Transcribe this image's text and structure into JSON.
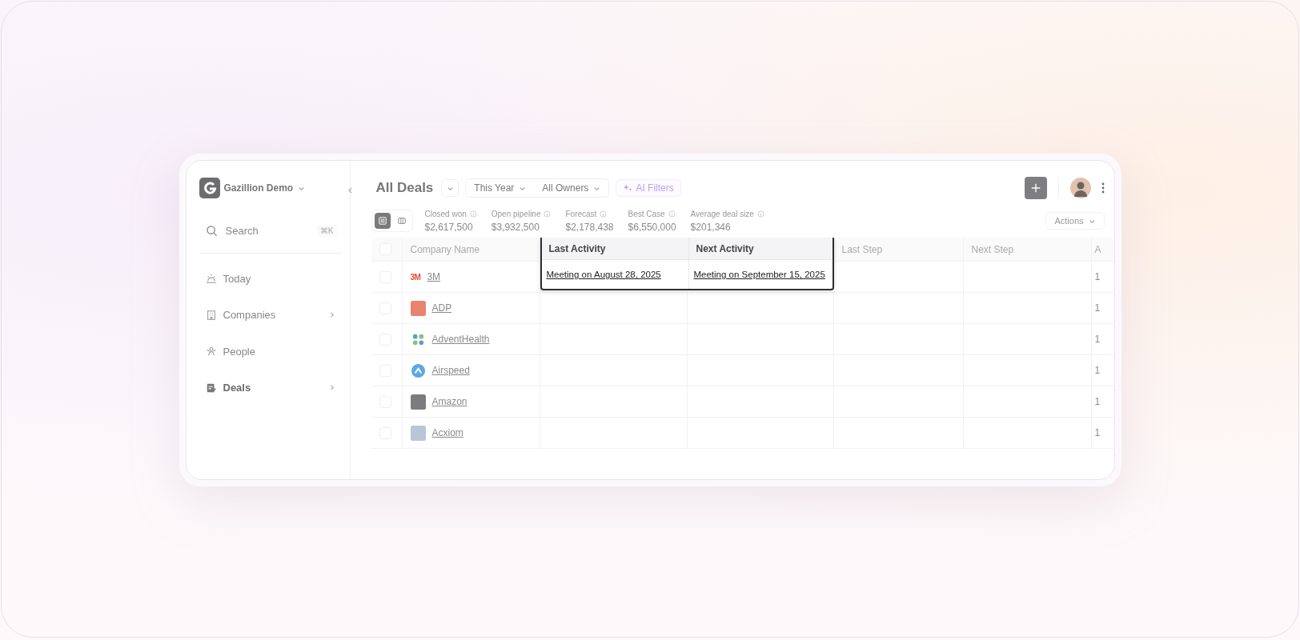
{
  "workspace": {
    "name": "Gazillion Demo"
  },
  "sidebar": {
    "search": {
      "placeholder": "Search",
      "shortcut": "⌘K"
    },
    "items": [
      {
        "label": "Today",
        "selected": false,
        "has_submenu": false
      },
      {
        "label": "Companies",
        "selected": false,
        "has_submenu": true
      },
      {
        "label": "People",
        "selected": false,
        "has_submenu": false
      },
      {
        "label": "Deals",
        "selected": true,
        "has_submenu": true
      }
    ]
  },
  "header": {
    "title": "All Deals",
    "filters": [
      "This Year",
      "All Owners"
    ],
    "ai_filters": "AI Filters"
  },
  "views": [
    {
      "kind": "list",
      "selected": true
    },
    {
      "kind": "board",
      "selected": false
    }
  ],
  "metrics": [
    {
      "label": "Closed won",
      "value": "$2,617,500"
    },
    {
      "label": "Open pipeline",
      "value": "$3,932,500"
    },
    {
      "label": "Forecast",
      "value": "$2,178,438"
    },
    {
      "label": "Best Case",
      "value": "$6,550,000"
    },
    {
      "label": "Average deal size",
      "value": "$201,346"
    }
  ],
  "actions": "Actions",
  "table": {
    "all_checked": false,
    "columns": [
      {
        "label": "Company Name",
        "highlighted": false
      },
      {
        "label": "Last Activity",
        "highlighted": true
      },
      {
        "label": "Next Activity",
        "highlighted": true
      },
      {
        "label": "Last Step",
        "highlighted": false
      },
      {
        "label": "Next Step",
        "highlighted": false
      },
      {
        "label": "A",
        "highlighted": false
      }
    ],
    "rows": [
      {
        "checked": false,
        "logo": {
          "kind": "wordmark",
          "text": "3M",
          "color": "#ef4a35"
        },
        "cells": [
          "3M",
          "Meeting on August 28, 2025",
          "Meeting on September 15, 2025",
          "",
          "",
          "1"
        ]
      },
      {
        "checked": false,
        "logo": {
          "kind": "tile",
          "color": "#e8836e"
        },
        "cells": [
          "ADP",
          "",
          "",
          "",
          "",
          "1"
        ]
      },
      {
        "checked": false,
        "logo": {
          "kind": "dots",
          "color": "#5aa0c8"
        },
        "cells": [
          "AdventHealth",
          "",
          "",
          "",
          "",
          "1"
        ]
      },
      {
        "checked": false,
        "logo": {
          "kind": "circle",
          "color": "#5aa9e6"
        },
        "cells": [
          "Airspeed",
          "",
          "",
          "",
          "",
          "1"
        ]
      },
      {
        "checked": false,
        "logo": {
          "kind": "tile",
          "color": "#7d7a80"
        },
        "cells": [
          "Amazon",
          "",
          "",
          "",
          "",
          "1"
        ]
      },
      {
        "checked": false,
        "logo": {
          "kind": "tile",
          "color": "#b9c6d8"
        },
        "cells": [
          "Acxiom",
          "",
          "",
          "",
          "",
          "1"
        ]
      }
    ]
  }
}
